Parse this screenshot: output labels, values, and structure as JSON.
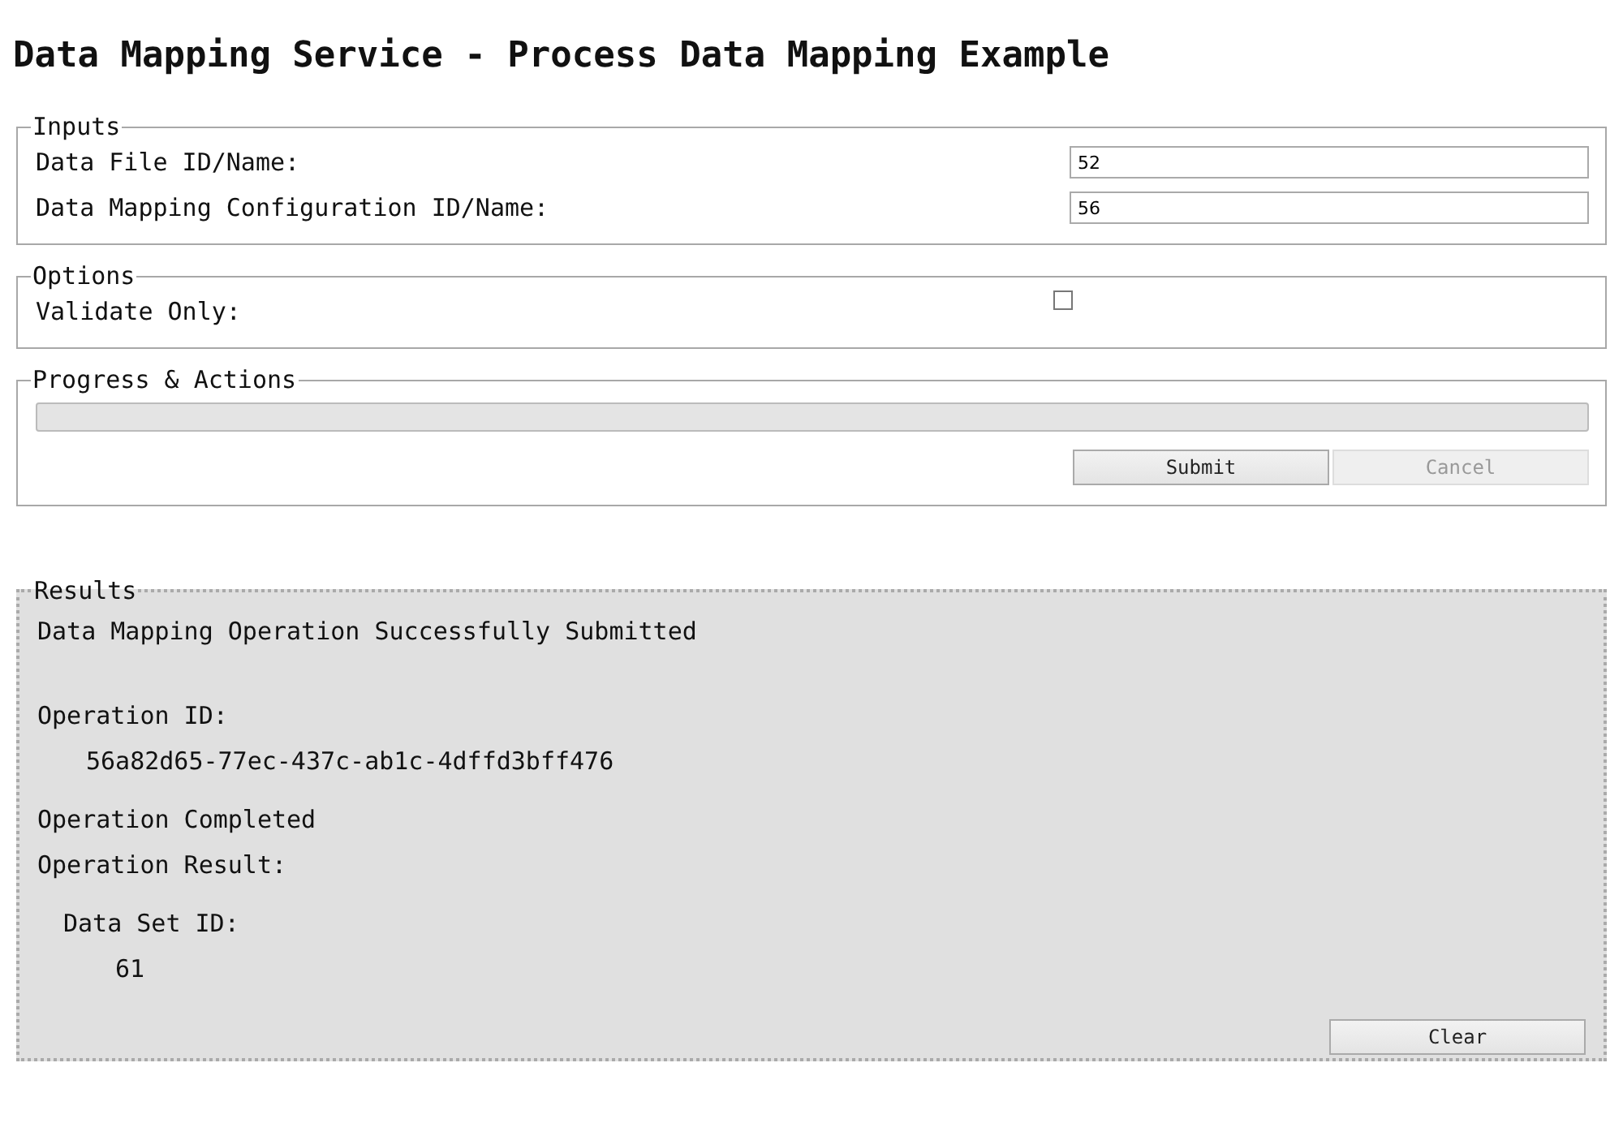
{
  "title": "Data Mapping Service - Process Data Mapping Example",
  "inputs": {
    "legend": "Inputs",
    "fields": [
      {
        "label": "Data File ID/Name:",
        "value": "52"
      },
      {
        "label": "Data Mapping Configuration ID/Name:",
        "value": "56"
      }
    ]
  },
  "options": {
    "legend": "Options",
    "items": [
      {
        "label": "Validate Only:",
        "checked": false
      }
    ]
  },
  "progress": {
    "legend": "Progress & Actions",
    "level": 0,
    "buttons": [
      {
        "label": "Submit",
        "disabled": false
      },
      {
        "label": "Cancel",
        "disabled": true
      }
    ]
  },
  "results": {
    "legend": "Results",
    "lines": [
      {
        "kind": "message",
        "text": "Data Mapping Operation Successfully Submitted"
      },
      {
        "kind": "label",
        "text": "Operation ID:"
      },
      {
        "kind": "value",
        "text": "56a82d65-77ec-437c-ab1c-4dffd3bff476"
      },
      {
        "kind": "label",
        "text": "Operation Completed"
      },
      {
        "kind": "label",
        "text": "Operation Result:"
      },
      {
        "kind": "sublabel",
        "text": "Data Set ID:"
      },
      {
        "kind": "subvalue",
        "text": "61"
      }
    ],
    "button": {
      "label": "Clear",
      "disabled": false
    }
  }
}
